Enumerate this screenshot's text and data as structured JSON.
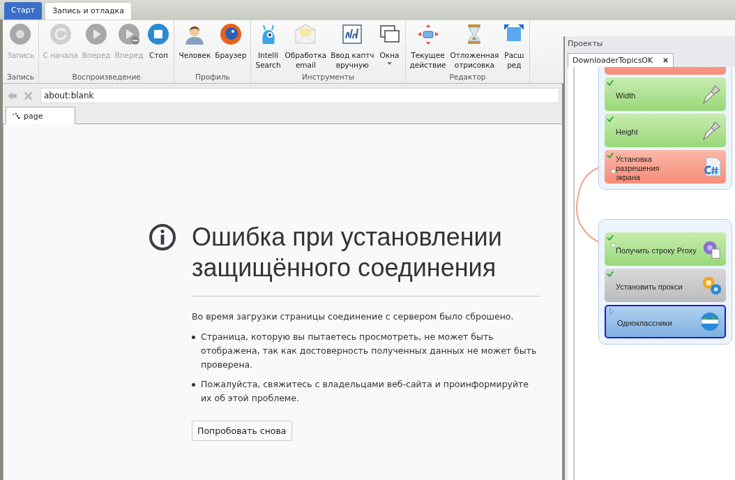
{
  "ribbon_tabs": [
    {
      "label": "Старт",
      "selected": false
    },
    {
      "label": "Запись и отладка",
      "selected": true
    }
  ],
  "ribbon_groups": [
    {
      "label": "Запись",
      "buttons": [
        {
          "lines": [
            "Запись"
          ],
          "disabled": true,
          "dropdown": false
        }
      ]
    },
    {
      "label": "Воспроизведение",
      "buttons": [
        {
          "lines": [
            "С начала"
          ],
          "disabled": true,
          "dropdown": false
        },
        {
          "lines": [
            "Вперед"
          ],
          "disabled": true,
          "dropdown": false
        },
        {
          "lines": [
            "Вперед"
          ],
          "disabled": true,
          "dropdown": false
        },
        {
          "lines": [
            "Стоп"
          ],
          "disabled": false,
          "dropdown": false
        }
      ]
    },
    {
      "label": "Профиль",
      "buttons": [
        {
          "lines": [
            "Человек"
          ],
          "disabled": false,
          "dropdown": false
        },
        {
          "lines": [
            "Браузер"
          ],
          "disabled": false,
          "dropdown": false
        }
      ]
    },
    {
      "label": "Инструменты",
      "buttons": [
        {
          "lines": [
            "Intelli",
            "Search"
          ],
          "disabled": false,
          "dropdown": false
        },
        {
          "lines": [
            "Обработка",
            "email"
          ],
          "disabled": false,
          "dropdown": false
        },
        {
          "lines": [
            "Ввод каптч",
            "вручную"
          ],
          "disabled": false,
          "dropdown": false
        },
        {
          "lines": [
            "Окна"
          ],
          "disabled": false,
          "dropdown": true
        }
      ]
    },
    {
      "label": "Редактор",
      "buttons": [
        {
          "lines": [
            "Текущее",
            "действие"
          ],
          "disabled": false,
          "dropdown": false
        },
        {
          "lines": [
            "Отложенная",
            "отрисовка"
          ],
          "disabled": false,
          "dropdown": false
        },
        {
          "lines": [
            "Расш",
            "ред"
          ],
          "disabled": false,
          "dropdown": false
        }
      ]
    }
  ],
  "address_bar": {
    "value": "about:blank"
  },
  "browser_tabs": [
    {
      "label": "page",
      "selected": true
    }
  ],
  "error_page": {
    "title": "Ошибка при установлении защищённого соединения",
    "message": "Во время загрузки страницы соединение с сервером было сброшено.",
    "bullets": [
      "Страница, которую вы пытаетесь просмотреть, не может быть отображена, так как достоверность полученных данных не может быть проверена.",
      "Пожалуйста, свяжитесь с владельцами веб-сайта и проинформируйте их об этой проблеме."
    ],
    "button": "Попробовать снова"
  },
  "projects_panel": {
    "title": "Проекты",
    "tabs": [
      {
        "label": "DownloaderTopicsOK",
        "selected": true
      }
    ],
    "groups": [
      {
        "nodes": [
          {
            "kind": "error",
            "checked": false
          },
          {
            "label": "Width",
            "kind": "success",
            "checked": true
          },
          {
            "label": "Height",
            "kind": "success",
            "checked": true
          },
          {
            "label": "Установка разрешения экрана",
            "kind": "error",
            "checked": true
          }
        ]
      },
      {
        "nodes": [
          {
            "label": "Получить строку Proxy",
            "kind": "success",
            "checked": true
          },
          {
            "label": "Установить прокси",
            "kind": "neutral",
            "checked": true
          },
          {
            "label": "Одноклассники",
            "kind": "active",
            "checked": false
          }
        ]
      }
    ]
  }
}
